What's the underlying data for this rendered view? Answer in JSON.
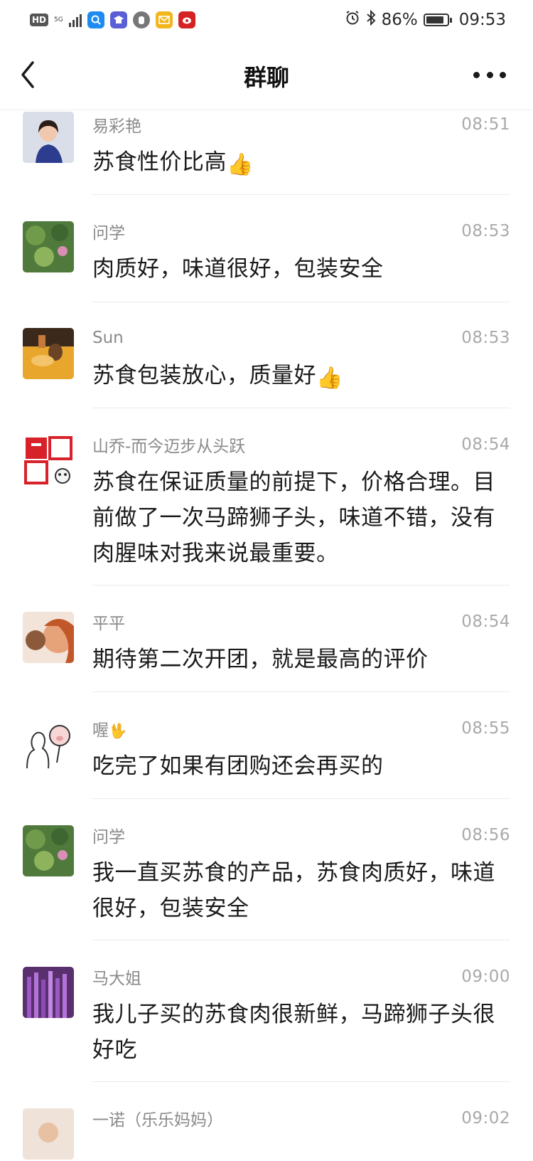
{
  "status_bar": {
    "hd": "HD",
    "network": "5G",
    "battery": "86%",
    "time": "09:53"
  },
  "nav": {
    "title": "群聊"
  },
  "messages": [
    {
      "name": "易彩艳",
      "time": "08:51",
      "text": "苏食性价比高",
      "emoji": "👍"
    },
    {
      "name": "问学",
      "time": "08:53",
      "text": "肉质好，味道很好，包装安全",
      "emoji": ""
    },
    {
      "name": "Sun",
      "time": "08:53",
      "text": "苏食包装放心，质量好",
      "emoji": "👍"
    },
    {
      "name": "山乔-而今迈步从头跃",
      "time": "08:54",
      "text": "苏食在保证质量的前提下，价格合理。目前做了一次马蹄狮子头，味道不错，没有肉腥味对我来说最重要。",
      "emoji": ""
    },
    {
      "name": "平平",
      "time": "08:54",
      "text": "期待第二次开团，就是最高的评价",
      "emoji": ""
    },
    {
      "name": "喔",
      "name_emoji": "🖖",
      "time": "08:55",
      "text": "吃完了如果有团购还会再买的",
      "emoji": ""
    },
    {
      "name": "问学",
      "time": "08:56",
      "text": "我一直买苏食的产品，苏食肉质好，味道很好，包装安全",
      "emoji": ""
    },
    {
      "name": "马大姐",
      "time": "09:00",
      "text": "我儿子买的苏食肉很新鲜，马蹄狮子头很好吃",
      "emoji": ""
    },
    {
      "name": "一诺（乐乐妈妈）",
      "time": "09:02",
      "text": "",
      "emoji": ""
    }
  ]
}
